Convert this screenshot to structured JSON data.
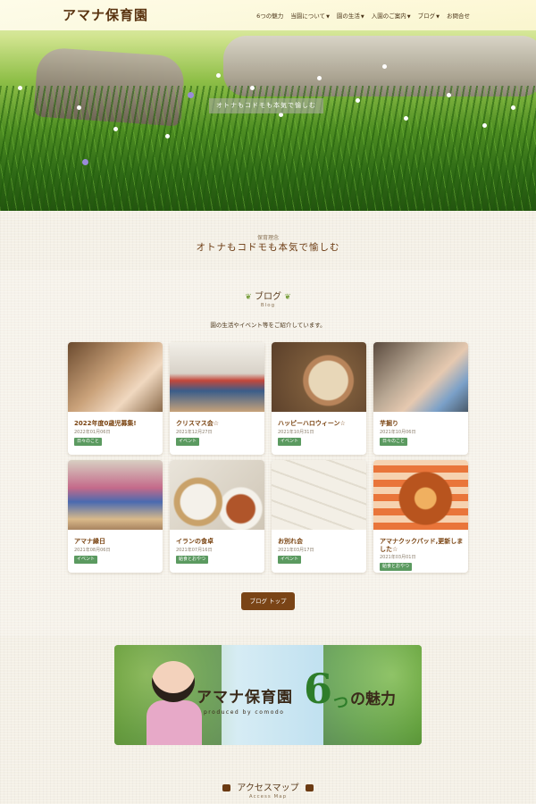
{
  "header": {
    "logo": "アマナ保育園",
    "nav": [
      {
        "label": "6つの魅力",
        "dropdown": false
      },
      {
        "label": "当園について",
        "dropdown": true
      },
      {
        "label": "園の生活",
        "dropdown": true
      },
      {
        "label": "入園のご案内",
        "dropdown": true
      },
      {
        "label": "ブログ",
        "dropdown": true
      },
      {
        "label": "お問合せ",
        "dropdown": false
      }
    ]
  },
  "hero": {
    "caption": "オトナもコドモも本気で愉しむ"
  },
  "motto": {
    "label": "保育理念",
    "text": "オトナもコドモも本気で愉しむ"
  },
  "blog": {
    "title": "ブログ",
    "subtitle": "Blog",
    "description": "園の生活やイベント等をご紹介しています。",
    "posts": [
      {
        "title": "2022年度0歳児募集!",
        "date": "2022年01月06日",
        "tag": "日々のこと"
      },
      {
        "title": "クリスマス会☆",
        "date": "2021年12月27日",
        "tag": "イベント"
      },
      {
        "title": "ハッピーハロウィーン☆",
        "date": "2021年10月31日",
        "tag": "イベント"
      },
      {
        "title": "芋掘り",
        "date": "2021年10月06日",
        "tag": "日々のこと"
      },
      {
        "title": "アマナ縁日",
        "date": "2021年08月06日",
        "tag": "イベント"
      },
      {
        "title": "イランの食卓",
        "date": "2021年07月16日",
        "tag": "給食とおやつ"
      },
      {
        "title": "お別れ会",
        "date": "2021年03月17日",
        "tag": "イベント"
      },
      {
        "title": "アマナクックパッド,更新しました☆",
        "date": "2021年03月01日",
        "tag": "給食とおやつ"
      }
    ],
    "button": "ブログ トップ"
  },
  "banner": {
    "name": "アマナ保育園",
    "six": "6",
    "tsu": "つ",
    "miryoku": "の魅力",
    "produced": "produced by comodo"
  },
  "access": {
    "title": "アクセスマップ",
    "subtitle": "Access Map"
  },
  "colors": {
    "accent": "#7a4416",
    "tag": "#5b9a60",
    "title": "#7a4412"
  }
}
